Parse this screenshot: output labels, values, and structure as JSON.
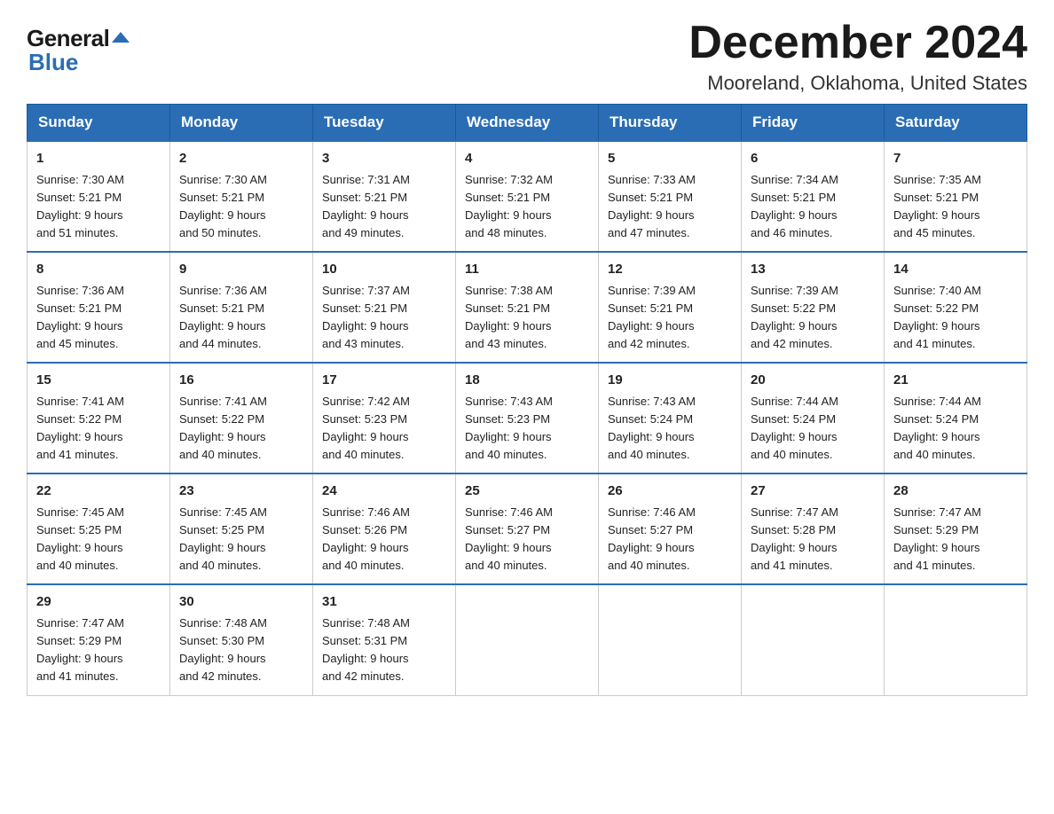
{
  "logo": {
    "general": "General",
    "blue": "Blue",
    "arrow": "▶"
  },
  "title": "December 2024",
  "subtitle": "Mooreland, Oklahoma, United States",
  "weekdays": [
    "Sunday",
    "Monday",
    "Tuesday",
    "Wednesday",
    "Thursday",
    "Friday",
    "Saturday"
  ],
  "weeks": [
    [
      {
        "day": "1",
        "sunrise": "7:30 AM",
        "sunset": "5:21 PM",
        "daylight": "9 hours and 51 minutes."
      },
      {
        "day": "2",
        "sunrise": "7:30 AM",
        "sunset": "5:21 PM",
        "daylight": "9 hours and 50 minutes."
      },
      {
        "day": "3",
        "sunrise": "7:31 AM",
        "sunset": "5:21 PM",
        "daylight": "9 hours and 49 minutes."
      },
      {
        "day": "4",
        "sunrise": "7:32 AM",
        "sunset": "5:21 PM",
        "daylight": "9 hours and 48 minutes."
      },
      {
        "day": "5",
        "sunrise": "7:33 AM",
        "sunset": "5:21 PM",
        "daylight": "9 hours and 47 minutes."
      },
      {
        "day": "6",
        "sunrise": "7:34 AM",
        "sunset": "5:21 PM",
        "daylight": "9 hours and 46 minutes."
      },
      {
        "day": "7",
        "sunrise": "7:35 AM",
        "sunset": "5:21 PM",
        "daylight": "9 hours and 45 minutes."
      }
    ],
    [
      {
        "day": "8",
        "sunrise": "7:36 AM",
        "sunset": "5:21 PM",
        "daylight": "9 hours and 45 minutes."
      },
      {
        "day": "9",
        "sunrise": "7:36 AM",
        "sunset": "5:21 PM",
        "daylight": "9 hours and 44 minutes."
      },
      {
        "day": "10",
        "sunrise": "7:37 AM",
        "sunset": "5:21 PM",
        "daylight": "9 hours and 43 minutes."
      },
      {
        "day": "11",
        "sunrise": "7:38 AM",
        "sunset": "5:21 PM",
        "daylight": "9 hours and 43 minutes."
      },
      {
        "day": "12",
        "sunrise": "7:39 AM",
        "sunset": "5:21 PM",
        "daylight": "9 hours and 42 minutes."
      },
      {
        "day": "13",
        "sunrise": "7:39 AM",
        "sunset": "5:22 PM",
        "daylight": "9 hours and 42 minutes."
      },
      {
        "day": "14",
        "sunrise": "7:40 AM",
        "sunset": "5:22 PM",
        "daylight": "9 hours and 41 minutes."
      }
    ],
    [
      {
        "day": "15",
        "sunrise": "7:41 AM",
        "sunset": "5:22 PM",
        "daylight": "9 hours and 41 minutes."
      },
      {
        "day": "16",
        "sunrise": "7:41 AM",
        "sunset": "5:22 PM",
        "daylight": "9 hours and 40 minutes."
      },
      {
        "day": "17",
        "sunrise": "7:42 AM",
        "sunset": "5:23 PM",
        "daylight": "9 hours and 40 minutes."
      },
      {
        "day": "18",
        "sunrise": "7:43 AM",
        "sunset": "5:23 PM",
        "daylight": "9 hours and 40 minutes."
      },
      {
        "day": "19",
        "sunrise": "7:43 AM",
        "sunset": "5:24 PM",
        "daylight": "9 hours and 40 minutes."
      },
      {
        "day": "20",
        "sunrise": "7:44 AM",
        "sunset": "5:24 PM",
        "daylight": "9 hours and 40 minutes."
      },
      {
        "day": "21",
        "sunrise": "7:44 AM",
        "sunset": "5:24 PM",
        "daylight": "9 hours and 40 minutes."
      }
    ],
    [
      {
        "day": "22",
        "sunrise": "7:45 AM",
        "sunset": "5:25 PM",
        "daylight": "9 hours and 40 minutes."
      },
      {
        "day": "23",
        "sunrise": "7:45 AM",
        "sunset": "5:25 PM",
        "daylight": "9 hours and 40 minutes."
      },
      {
        "day": "24",
        "sunrise": "7:46 AM",
        "sunset": "5:26 PM",
        "daylight": "9 hours and 40 minutes."
      },
      {
        "day": "25",
        "sunrise": "7:46 AM",
        "sunset": "5:27 PM",
        "daylight": "9 hours and 40 minutes."
      },
      {
        "day": "26",
        "sunrise": "7:46 AM",
        "sunset": "5:27 PM",
        "daylight": "9 hours and 40 minutes."
      },
      {
        "day": "27",
        "sunrise": "7:47 AM",
        "sunset": "5:28 PM",
        "daylight": "9 hours and 41 minutes."
      },
      {
        "day": "28",
        "sunrise": "7:47 AM",
        "sunset": "5:29 PM",
        "daylight": "9 hours and 41 minutes."
      }
    ],
    [
      {
        "day": "29",
        "sunrise": "7:47 AM",
        "sunset": "5:29 PM",
        "daylight": "9 hours and 41 minutes."
      },
      {
        "day": "30",
        "sunrise": "7:48 AM",
        "sunset": "5:30 PM",
        "daylight": "9 hours and 42 minutes."
      },
      {
        "day": "31",
        "sunrise": "7:48 AM",
        "sunset": "5:31 PM",
        "daylight": "9 hours and 42 minutes."
      },
      null,
      null,
      null,
      null
    ]
  ],
  "labels": {
    "sunrise": "Sunrise:",
    "sunset": "Sunset:",
    "daylight": "Daylight:"
  }
}
